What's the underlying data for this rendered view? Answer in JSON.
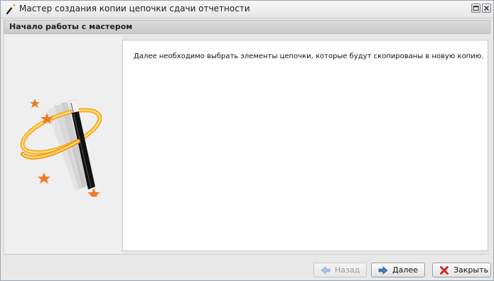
{
  "window": {
    "title": "Мастер создания копии цепочки сдачи отчетности",
    "controls": [
      "maximize-icon",
      "close-icon"
    ]
  },
  "section": {
    "title": "Начало работы с мастером"
  },
  "left_panel": {
    "illustration": "magic-wand-icon"
  },
  "content": {
    "text": "Далее необходимо выбрать элементы цепочки, которые будут скопированы в новую копию."
  },
  "buttons": {
    "back": {
      "label": "Назад",
      "icon": "arrow-left-icon",
      "enabled": false
    },
    "next": {
      "label": "Далее",
      "icon": "arrow-right-icon",
      "enabled": true
    },
    "close": {
      "label": "Закрыть",
      "icon": "red-x-icon",
      "enabled": true
    }
  },
  "colors": {
    "accent_arrow": "#3f7fc2",
    "close_red": "#d42b2b",
    "ring_orange": "#f5a21f"
  }
}
